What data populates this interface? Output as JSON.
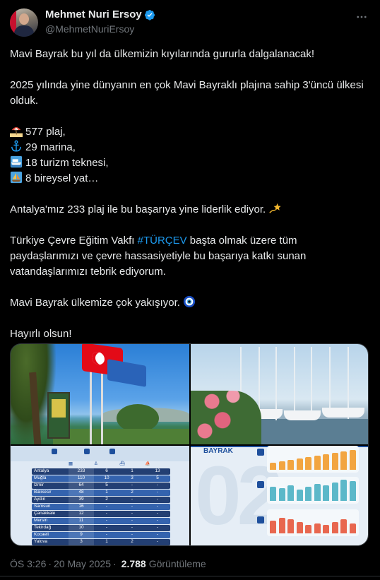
{
  "author": {
    "display_name": "Mehmet Nuri Ersoy",
    "handle": "@MehmetNuriErsoy",
    "verified_icon": "verified-badge-icon"
  },
  "tweet": {
    "line1": "Mavi Bayrak bu yıl da ülkemizin kıyılarında gururla dalgalanacak!",
    "line2": "2025 yılında yine dünyanın en çok Mavi Bayraklı plajına sahip 3'üncü ülkesi olduk.",
    "stats": [
      {
        "icon": "beach-umbrella-icon",
        "text": "577 plaj,"
      },
      {
        "icon": "anchor-icon",
        "text": "29 marina,"
      },
      {
        "icon": "ship-icon",
        "text": "18 turizm teknesi,"
      },
      {
        "icon": "sailboat-icon",
        "text": "8 bireysel yat…"
      }
    ],
    "line3": "Antalya'mız 233 plaj ile bu başarıya yine liderlik ediyor.",
    "line3_icon": "dizzy-star-icon",
    "line4_before": "Türkiye Çevre Eğitim Vakfı ",
    "hashtag": "#TÜRÇEV",
    "line4_after": " başta olmak üzere tüm paydaşlarımızı ve çevre hassasiyetiyle bu başarıya katkı sunan vatandaşlarımızı tebrik ediyorum.",
    "line5": "Mavi Bayrak ülkemize çok yakışıyor.",
    "line5_icon": "nazar-amulet-icon",
    "line6": "Hayırlı olsun!"
  },
  "media": {
    "table": {
      "rows": [
        [
          "Antalya",
          "233",
          "6",
          "1",
          "13"
        ],
        [
          "Muğla",
          "110",
          "10",
          "3",
          "5"
        ],
        [
          "İzmir",
          "64",
          "5",
          "-",
          "-"
        ],
        [
          "Balıkesir",
          "48",
          "1",
          "2",
          "-"
        ],
        [
          "Aydın",
          "39",
          "2",
          "-",
          "-"
        ],
        [
          "Samsun",
          "16",
          "-",
          "-",
          "-"
        ],
        [
          "Çanakkale",
          "12",
          "-",
          "-",
          "-"
        ],
        [
          "Mersin",
          "11",
          "-",
          "-",
          "-"
        ],
        [
          "Tekirdağ",
          "10",
          "-",
          "-",
          "-"
        ],
        [
          "Kocaeli",
          "9",
          "-",
          "-",
          "-"
        ],
        [
          "Yalova",
          "3",
          "1",
          "2",
          "-"
        ]
      ]
    },
    "chart_brand": "BAYRAK",
    "chart_watermark": "02"
  },
  "footer": {
    "time": "ÖS 3:26",
    "date": "20 May 2025",
    "separator": "·",
    "views_count": "2.788",
    "views_label": "Görüntüleme"
  },
  "colors": {
    "background": "#000000",
    "text": "#e7e9ea",
    "muted": "#71767b",
    "link": "#1d9bf0",
    "verified": "#1d9bf0"
  }
}
